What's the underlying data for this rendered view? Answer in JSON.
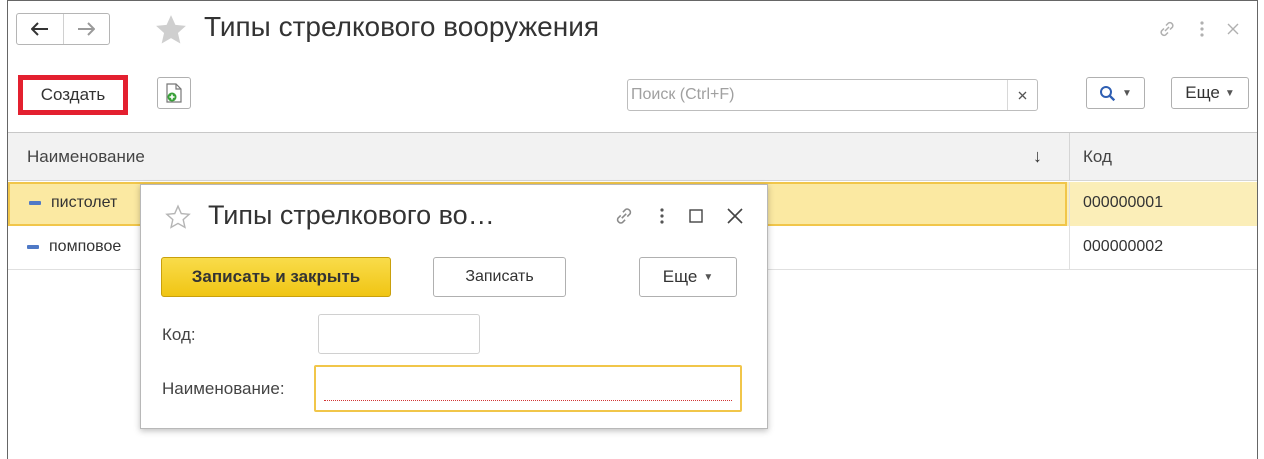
{
  "window": {
    "title": "Типы стрелкового вооружения",
    "icons": [
      "back-arrow-icon",
      "forward-arrow-icon",
      "star-icon",
      "link-icon",
      "more-vertical-icon",
      "close-icon"
    ]
  },
  "toolbar": {
    "create_label": "Создать",
    "copy_icon": "copy-add-icon",
    "search": {
      "placeholder": "Поиск (Ctrl+F)",
      "value": "",
      "clear_label": "×"
    },
    "more_label": "Еще"
  },
  "table": {
    "columns": [
      "Наименование",
      "Код"
    ],
    "sort_indicator": "↓",
    "rows": [
      {
        "name": "пистолет",
        "code": "000000001",
        "selected": true
      },
      {
        "name": "помповое",
        "code": "000000002",
        "selected": false
      }
    ]
  },
  "dialog": {
    "title": "Типы стрелкового во…",
    "save_close_label": "Записать и закрыть",
    "save_label": "Записать",
    "more_label": "Еще",
    "fields": {
      "code_label": "Код:",
      "code_value": "",
      "name_label": "Наименование:",
      "name_value": ""
    }
  },
  "colors": {
    "highlight": "#e3202f",
    "primary_button": "#f5d02a",
    "selected_row": "#fbeeb8",
    "focus_border": "#f1c64a",
    "row_marker": "#4f79c6"
  }
}
